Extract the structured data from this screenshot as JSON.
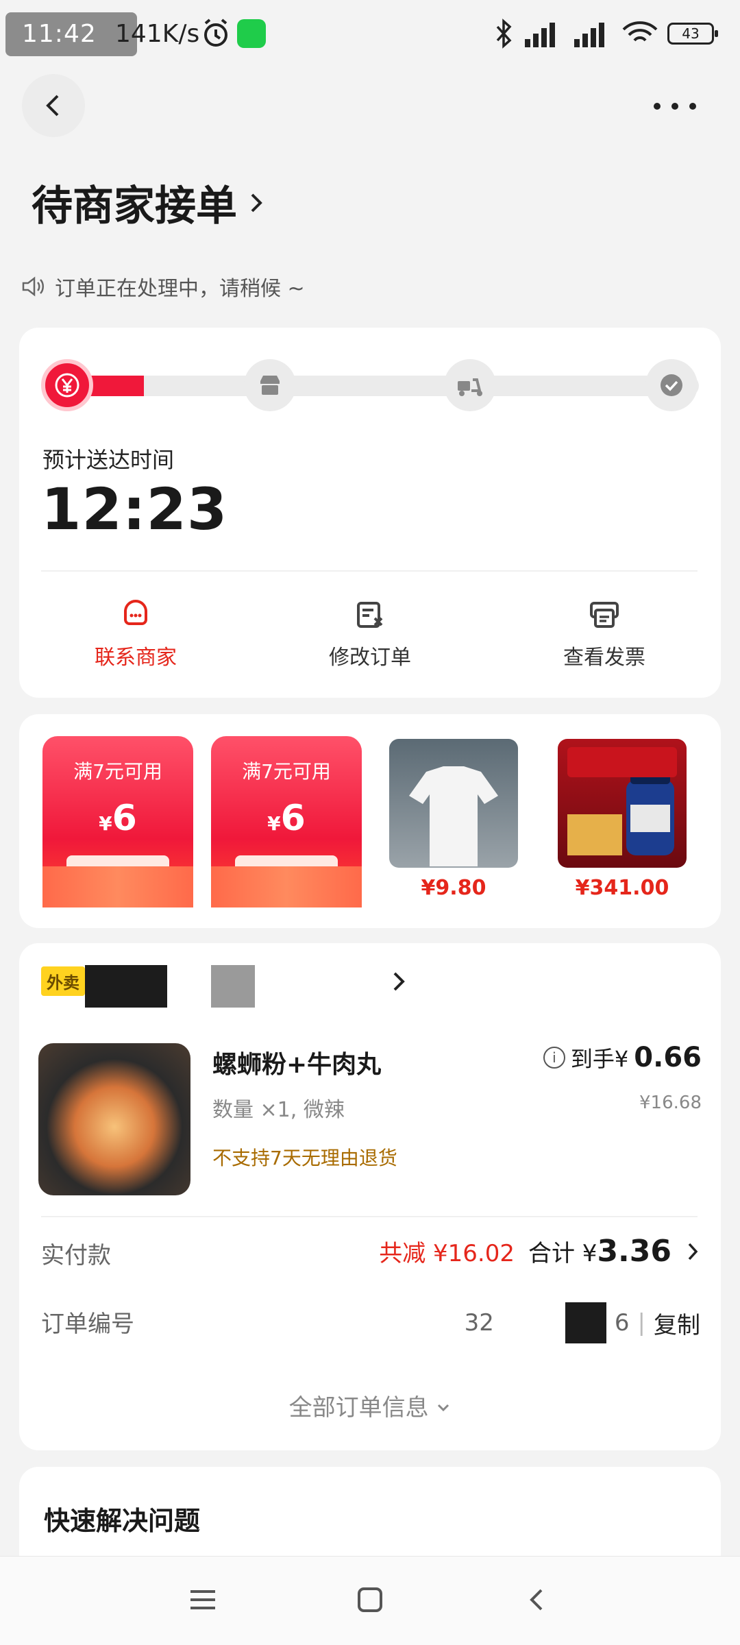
{
  "status_bar": {
    "time": "11:42",
    "speed": "141K/s",
    "battery": "43"
  },
  "header": {
    "title": "待商家接单",
    "notice": "订单正在处理中，请稍候 ~"
  },
  "delivery": {
    "progress_steps": [
      "payment",
      "store",
      "courier",
      "delivered"
    ],
    "current_step": 1,
    "eta_label": "预计送达时间",
    "eta_time": "12:23",
    "actions": [
      {
        "label": "联系商家",
        "icon": "chat-bag-icon",
        "highlight": true
      },
      {
        "label": "修改订单",
        "icon": "edit-order-icon",
        "highlight": false
      },
      {
        "label": "查看发票",
        "icon": "invoice-icon",
        "highlight": false
      }
    ]
  },
  "promotions": {
    "coupons": [
      {
        "condition": "满7元可用",
        "currency": "¥",
        "amount": "6"
      },
      {
        "condition": "满7元可用",
        "currency": "¥",
        "amount": "6"
      }
    ],
    "products": [
      {
        "price": "¥9.80",
        "image": "white-tshirt-photo"
      },
      {
        "price": "¥341.00",
        "image": "coq10-supplement-photo"
      }
    ]
  },
  "order": {
    "shop_tag": "外卖",
    "item": {
      "name": "螺蛳粉+牛肉丸",
      "spec": "数量 ×1, 微辣",
      "warning": "不支持7天无理由退货",
      "price_prefix": "到手¥",
      "price_value": "0.66",
      "original_price": "¥16.68"
    },
    "payment": {
      "label": "实付款",
      "discount": "共减 ¥16.02",
      "total_prefix": "合计 ¥",
      "total_value": "3.36"
    },
    "order_no": {
      "label": "订单编号",
      "visible_start": "32",
      "visible_end": "6",
      "copy_label": "复制"
    },
    "all_info_label": "全部订单信息"
  },
  "quick_help": {
    "title": "快速解决问题"
  },
  "colors": {
    "accent": "#f0183a",
    "accent_text": "#e5261b",
    "warning_text": "#a86b00",
    "tag_yellow": "#ffd21f"
  }
}
